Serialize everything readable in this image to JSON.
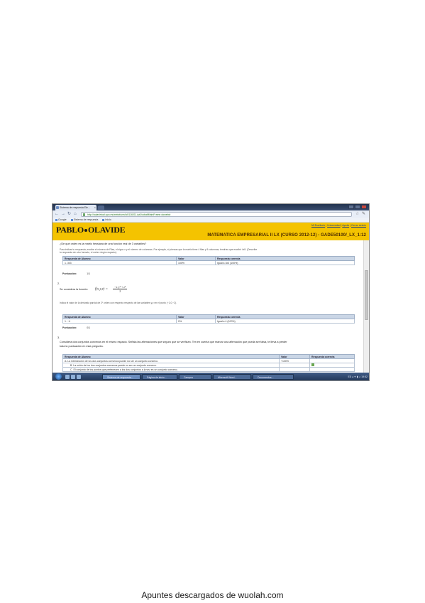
{
  "browser": {
    "tab_title": "Sistema de respuesta Ele...",
    "address": "http://aulavirtual.upo.es/webct/urw/lc5116011.tp0/cobaltMainFrame.dowebct",
    "bookmarks": [
      "Google",
      "Sistema de respuesta",
      "Inicio"
    ]
  },
  "header": {
    "logo_left": "PABLO",
    "logo_right": "OLAVIDE",
    "links": [
      "Mi Escritorio",
      "Universidad",
      "Ayuda",
      "Cerrar sesión"
    ],
    "course_title": "MATEMATICA EMPRESARIAL II LX (CURSO 2012-12) - GADE50100/_LX_1:12"
  },
  "questions": [
    {
      "prompt": "¿De qué orden es la matriz hessiana de una función real de 3 variables?",
      "instructions": [
        "Para indicar tu respuesta, escribe el número de Filas, el signo x y el número de columnas. Por ejemplo, si piensas que la matriz tiene 4 filas y 5 columnas, tendrías que escribir 4x5. (Describe",
        "tu respuesta sin otro formato, ni meter ningún espacio)."
      ],
      "headers": [
        "Respuesta de Alumno",
        "Valor",
        "Respuesta correcta"
      ],
      "rows": [
        [
          "1.   3x3",
          "100%",
          "Igual a 3x3 (100%)"
        ]
      ],
      "score_label": "Puntuación:",
      "score": "1/1"
    },
    {
      "number": "2.",
      "prompt": "Se considera la función",
      "formula_lhs": "f(x,y,z) =",
      "formula_num": "−x·y² + z²",
      "formula_den": "2",
      "instructions": [
        "Indica el valor de la derivada parcial de 2º orden con respecto respecto de las variables y,z en el punto (−1,0,−2)."
      ],
      "headers": [
        "Respuesta de Alumno",
        "Valor",
        "Respuesta correcta"
      ],
      "rows": [
        [
          "1.   −4",
          "0%",
          "Igual a 4 (100%)"
        ]
      ],
      "score_label": "Puntuación:",
      "score": "0/1"
    },
    {
      "number": "3.",
      "prompt": "Considera dos conjuntos convexos en el mismo espacio. Señala las afirmaciones que seguro que se verifican. Ten en cuenta que marcar una afirmación que pueda ser falsa, te lleva a perder",
      "prompt2": "toda la puntuación en esta pregunta.",
      "headers": [
        "Respuesta de Alumno",
        "Valor",
        "Respuesta correcta"
      ],
      "rows": [
        [
          "A. La intersección de los dos conjuntos convexos puede no ser un conjunto convexo.",
          "+100%",
          ""
        ],
        [
          "B. La unión de los dos conjuntos convexos puede no ser un conjunto convexo.",
          "",
          "✔"
        ],
        [
          "C. El conjunto de los puntos que pertenecen a los dos conjuntos a la vez es un conjunto convexo.",
          "",
          ""
        ]
      ]
    }
  ],
  "taskbar": {
    "buttons": [
      "Sistema de respuesta...",
      "Página de inicio...",
      "Campus",
      "Microsoft Word...",
      "Documentos..."
    ],
    "tray": "ES ◂ ✦ ▮ ♫ 19:52"
  },
  "footer": {
    "text": "Apuntes descargados de wuolah.com"
  },
  "colors": {
    "header_yellow": "#f4c300",
    "table_header": "#cad6e6"
  }
}
